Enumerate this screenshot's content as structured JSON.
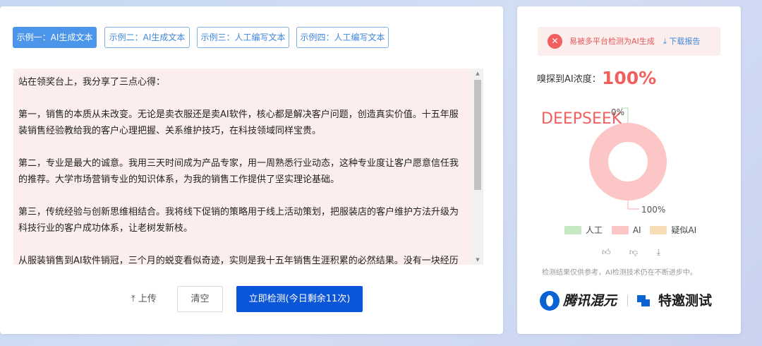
{
  "tabs": [
    {
      "label": "示例一：AI生成文本",
      "active": true
    },
    {
      "label": "示例二：AI生成文本",
      "active": false
    },
    {
      "label": "示例三：人工编写文本",
      "active": false
    },
    {
      "label": "示例四：人工编写文本",
      "active": false
    }
  ],
  "text_content": {
    "paragraphs": [
      "站在领奖台上，我分享了三点心得：",
      "第一，销售的本质从未改变。无论是卖衣服还是卖AI软件，核心都是解决客户问题，创造真实价值。十五年服装销售经验教给我的客户心理把握、关系维护技巧，在科技领域同样宝贵。",
      "第二，专业是最大的诚意。我用三天时间成为产品专家，用一周熟悉行业动态，这种专业度让客户愿意信任我的推荐。大学市场营销专业的知识体系，为我的销售工作提供了坚实理论基础。",
      "第三，传统经验与创新思维相结合。我将线下促销的策略用于线上活动策划，把服装店的客户维护方法升级为科技行业的客户成功体系，让老树发新枝。",
      "从服装销售到AI软件销冠，三个月的蜕变看似奇迹，实则是我十五年销售生涯积累的必然结果。没有一块经历是白费的——服装店的每一天教会我坚韧，社团外联的经历赋予我策划能力，大学专业知识给予我分析方法。"
    ]
  },
  "actions": {
    "upload_label": "上传",
    "upload_icon": "upload-arrow-icon",
    "clear_label": "清空",
    "detect_label": "立即检测(今日剩余11次)"
  },
  "result": {
    "alert_text": "易被多平台检测为AI生成",
    "download_label": "下载报告",
    "score_label": "嗅探到AI浓度：",
    "score_value": "100%",
    "disclaimer": "检测结果仅供参考，AI检测技术仍在不断进步中。"
  },
  "chart_data": {
    "type": "pie",
    "title": "",
    "categories": [
      "人工",
      "AI",
      "疑似AI"
    ],
    "values": [
      0,
      100,
      0
    ],
    "data_labels": [
      "0%",
      "100%"
    ],
    "colors": [
      "#c5e8c2",
      "#fcc6c6",
      "#f7ddb5"
    ],
    "donut": true,
    "legend_position": "bottom"
  },
  "watermark_text": "DEEPSEEK",
  "brands": {
    "brand1": "腾讯混元",
    "brand2": "特邀测试"
  },
  "colors": {
    "accent": "#4b96ea",
    "primary_button": "#0b55d8",
    "alert": "#f0605f",
    "text_bg": "#fdeeee"
  }
}
